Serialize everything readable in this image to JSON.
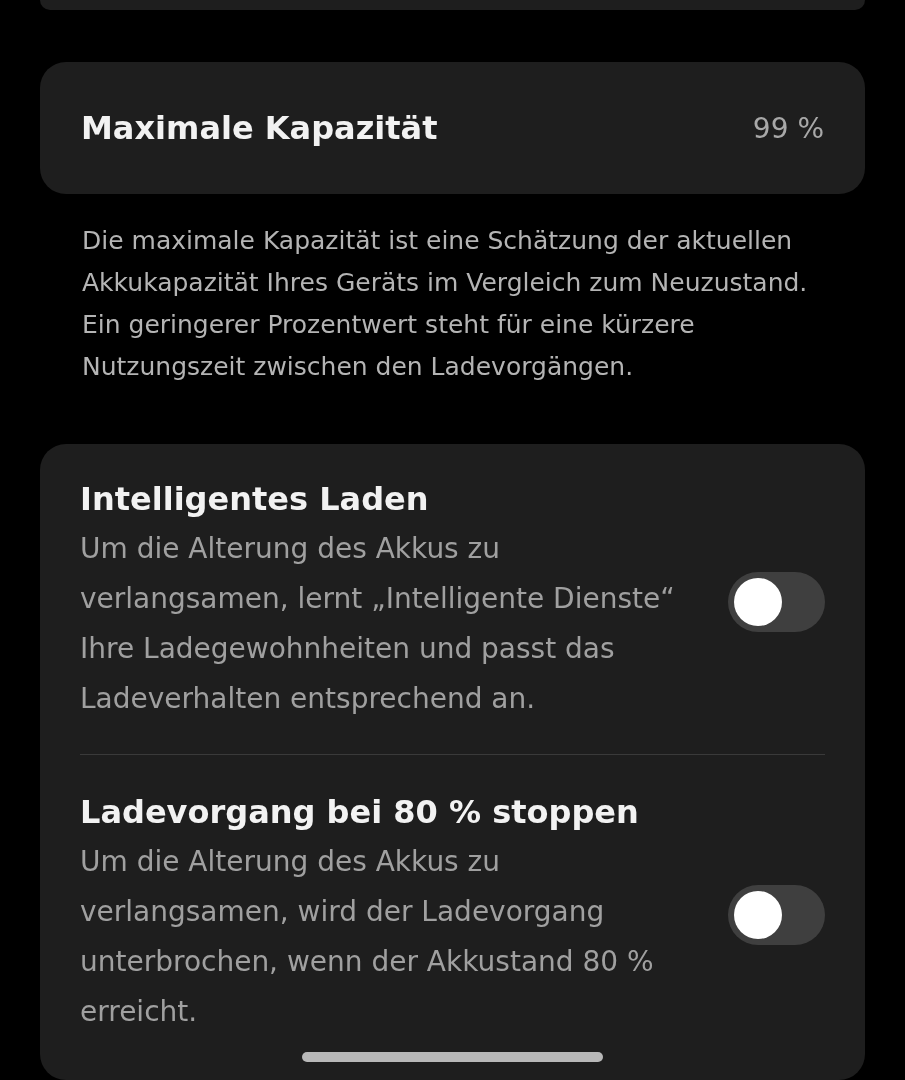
{
  "capacity": {
    "label": "Maximale Kapazität",
    "value": "99 %"
  },
  "capacity_note": "Die maximale Kapazität ist eine Schätzung der aktuellen Akkukapazität Ihres Geräts im Vergleich zum Neuzustand. Ein geringerer Prozentwert steht für eine kürzere Nutzungszeit zwischen den Ladevorgängen.",
  "toggles": [
    {
      "title": "Intelligentes Laden",
      "description": "Um die Alterung des Akkus zu verlangsamen, lernt „Intelligente Dienste“ Ihre Ladegewohnheiten und passt das Ladeverhalten entsprechend an.",
      "on": false
    },
    {
      "title": "Ladevorgang bei 80 % stoppen",
      "description": "Um die Alterung des Akkus zu verlangsamen, wird der Ladevorgang unterbrochen, wenn der Akkustand 80 % erreicht.",
      "on": false
    }
  ]
}
